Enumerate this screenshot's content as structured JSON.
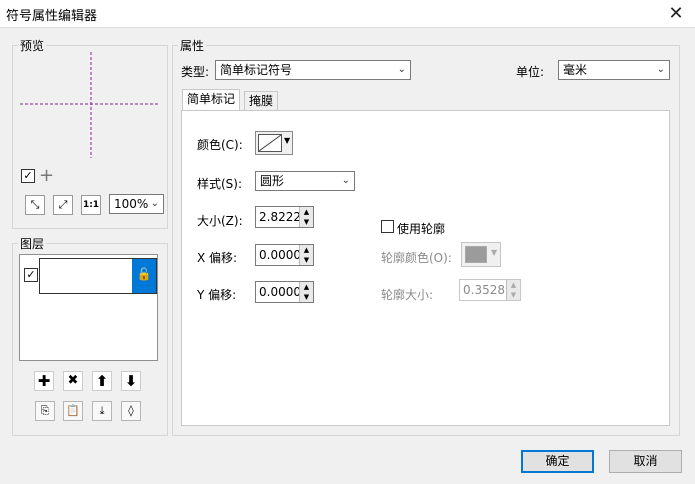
{
  "window": {
    "title": "符号属性编辑器",
    "close_glyph": "✕"
  },
  "preview": {
    "label": "预览",
    "crosshair_color": "#8b1f9a",
    "zoom_value": "100%",
    "zoom_arrow": "⌄",
    "tool_icons": [
      "fit-all-icon",
      "fit-expand-icon",
      "actual-size-icon"
    ],
    "tool_glyphs": [
      "⤡",
      "⤢",
      "1:1"
    ]
  },
  "layers": {
    "label": "图层",
    "actions": [
      {
        "name": "add-layer-button",
        "glyph": "✚"
      },
      {
        "name": "delete-layer-button",
        "glyph": "✖"
      },
      {
        "name": "move-up-button",
        "glyph": "⬆"
      },
      {
        "name": "move-down-button",
        "glyph": "⬇"
      }
    ],
    "extra": [
      {
        "name": "copy-icon",
        "glyph": "⎘"
      },
      {
        "name": "paste-icon",
        "glyph": "📋"
      },
      {
        "name": "import-icon",
        "glyph": "⤓"
      },
      {
        "name": "tag-icon",
        "glyph": "◊"
      }
    ]
  },
  "properties": {
    "label": "属性",
    "type_label": "类型:",
    "type_value": "简单标记符号",
    "unit_label": "单位:",
    "unit_value": "毫米",
    "tabs": [
      "简单标记",
      "掩膜"
    ]
  },
  "marker": {
    "color_label": "颜色(C):",
    "style_label": "样式(S):",
    "style_value": "圆形",
    "size_label": "大小(Z):",
    "size_value": "2.8222",
    "xoffset_label": "X 偏移:",
    "xoffset_value": "0.0000",
    "yoffset_label": "Y 偏移:",
    "yoffset_value": "0.0000",
    "use_outline_label": "使用轮廓",
    "outline_color_label": "轮廓颜色(O):",
    "outline_size_label": "轮廓大小:",
    "outline_size_value": "0.3528"
  },
  "buttons": {
    "ok": "确定",
    "cancel": "取消"
  }
}
